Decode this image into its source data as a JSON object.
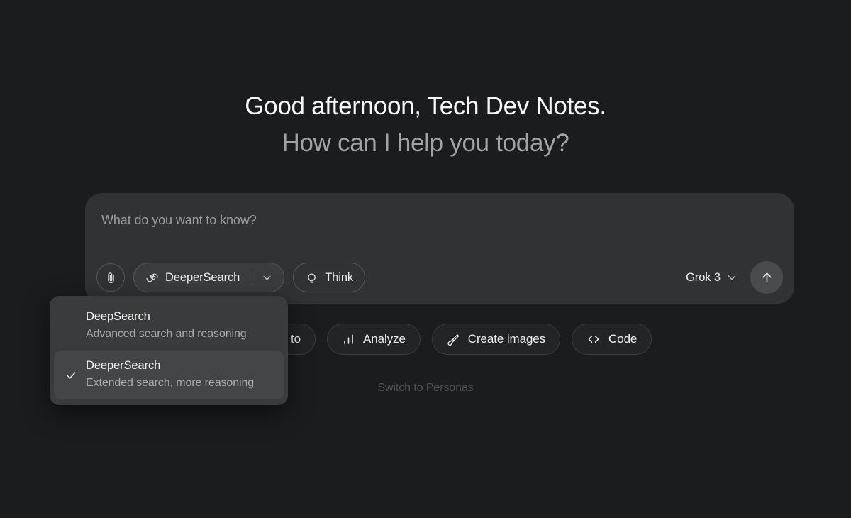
{
  "app": {
    "background_color": "#1a1c1d",
    "accent_color": "#f0f0f0"
  },
  "greeting": {
    "line1": "Good afternoon, Tech Dev Notes.",
    "line2": "How can I help you today?"
  },
  "composer": {
    "placeholder": "What do you want to know?",
    "attach": {
      "icon": "paperclip-icon",
      "label": "Attach"
    },
    "search_mode": {
      "icon": "spiral-icon",
      "label": "DeeperSearch",
      "caret_icon": "chevron-down-icon",
      "active": true
    },
    "think": {
      "icon": "lightbulb-icon",
      "label": "Think"
    },
    "model": {
      "label": "Grok 3",
      "caret_icon": "chevron-down-icon"
    },
    "send": {
      "icon": "arrow-up-icon",
      "label": "Send",
      "background": "#494b4d"
    }
  },
  "search_dropdown": {
    "background": "#3a3b3d",
    "selected_background": "#444547",
    "check_icon": "check-icon",
    "items": [
      {
        "title": "DeepSearch",
        "subtitle": "Advanced search and reasoning",
        "selected": false
      },
      {
        "title": "DeeperSearch",
        "subtitle": "Extended search, more reasoning",
        "selected": true
      }
    ]
  },
  "suggestions": [
    {
      "label": "How to",
      "icon": "lightning-icon"
    },
    {
      "label": "Analyze",
      "icon": "bar-chart-icon"
    },
    {
      "label": "Create images",
      "icon": "brush-icon"
    },
    {
      "label": "Code",
      "icon": "code-brackets-icon"
    }
  ],
  "personas": {
    "label": "Switch to Personas"
  }
}
